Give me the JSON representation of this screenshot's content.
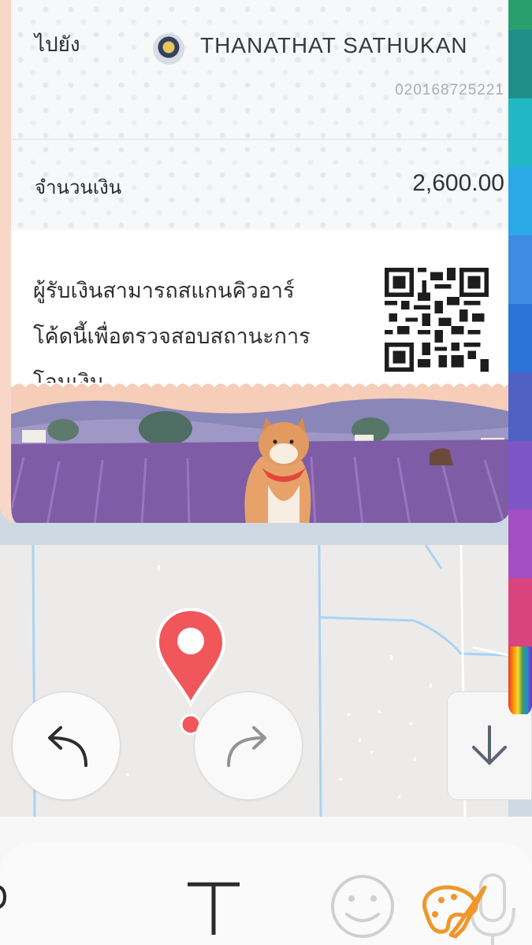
{
  "receipt": {
    "to_label": "ไปยัง",
    "recipient_name": "THANATHAT SATHUKAN",
    "account_number": "020168725221",
    "amount_label": "จำนวนเงิน",
    "amount_value": "2,600.00",
    "qr_note_lines": [
      "ผู้รับเงินสามารถสแกนคิวอาร์",
      "โค้ดนี้เพื่อตรวจสอบสถานะการ",
      "โอนเงิน"
    ]
  },
  "map": {
    "pin_icon": "map-pin-icon"
  },
  "controls": {
    "undo_icon": "undo-icon",
    "redo_icon": "redo-icon",
    "scroll_icon": "arrow-down-icon"
  },
  "toolbar": {
    "text_tool_icon": "text-icon",
    "emoji_icon": "smiley-icon",
    "palette_icon": "palette-icon",
    "mic_icon": "microphone-icon"
  },
  "palette_colors": [
    "#2a9f6e",
    "#1e8f8a",
    "#22b7c4",
    "#29a9e6",
    "#3f8be3",
    "#2c74d8",
    "#4f62c4",
    "#7d55c6",
    "#a34ec2",
    "#d9447e"
  ],
  "colors": {
    "pin_red": "#f0565a",
    "receipt_border": "#f8d7c9",
    "map_background": "#ecebea"
  }
}
